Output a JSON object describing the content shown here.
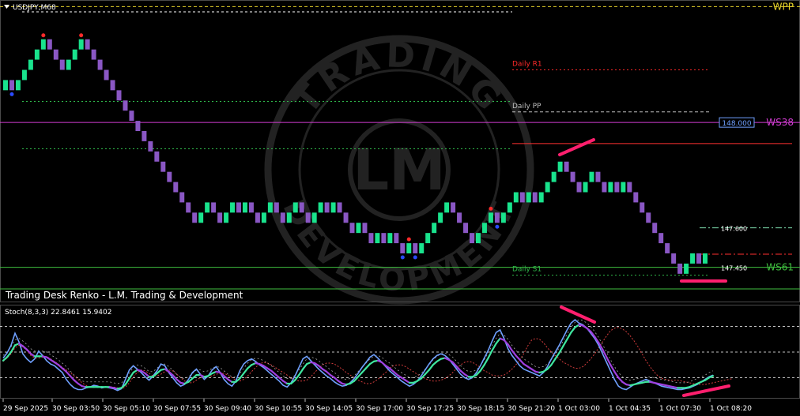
{
  "window": {
    "symbol_title": "USDJPY,M68",
    "indicator_title": "Trading Desk Renko - L.M. Trading & Development",
    "watermark": {
      "line1": "TRADING",
      "logo": "LM",
      "line2": "DEVELOPMENT"
    }
  },
  "colors": {
    "background": "#000000",
    "bull": "#19e38d",
    "bear": "#8a57c4",
    "accent": "#ff1f6e",
    "wpp": "#e6d22a",
    "ws38": "#d23cd2",
    "ws61": "#3fbf3f",
    "daily_r1": "#ff2a2a",
    "daily_pp": "#bfbfbf",
    "daily_s1": "#2fb84a",
    "stoch_main": "#6fa0ff",
    "stoch_signal": "#d23c3c",
    "stoch_smooth_up": "#3fe7a0",
    "stoch_smooth_down": "#a040e0"
  },
  "chart_data": [
    {
      "type": "renko",
      "symbol": "USDJPY",
      "timeframe": "M68",
      "ylim": [
        147.38,
        148.45
      ],
      "bricks": [
        {
          "dir": "up",
          "count": 1
        },
        {
          "dir": "down",
          "count": 1
        },
        {
          "dir": "up",
          "count": 5
        },
        {
          "dir": "down",
          "count": 3
        },
        {
          "dir": "up",
          "count": 3
        },
        {
          "dir": "down",
          "count": 18
        },
        {
          "dir": "up",
          "count": 2
        },
        {
          "dir": "down",
          "count": 2
        },
        {
          "dir": "up",
          "count": 2
        },
        {
          "dir": "down",
          "count": 1
        },
        {
          "dir": "up",
          "count": 1
        },
        {
          "dir": "down",
          "count": 2
        },
        {
          "dir": "up",
          "count": 2
        },
        {
          "dir": "down",
          "count": 2
        },
        {
          "dir": "up",
          "count": 2
        },
        {
          "dir": "down",
          "count": 2
        },
        {
          "dir": "up",
          "count": 2
        },
        {
          "dir": "down",
          "count": 1
        },
        {
          "dir": "up",
          "count": 1
        },
        {
          "dir": "down",
          "count": 3
        },
        {
          "dir": "up",
          "count": 1
        },
        {
          "dir": "down",
          "count": 2
        },
        {
          "dir": "up",
          "count": 1
        },
        {
          "dir": "down",
          "count": 1
        },
        {
          "dir": "up",
          "count": 1
        },
        {
          "dir": "down",
          "count": 2
        },
        {
          "dir": "up",
          "count": 1
        },
        {
          "dir": "down",
          "count": 1
        },
        {
          "dir": "up",
          "count": 5
        },
        {
          "dir": "down",
          "count": 4
        },
        {
          "dir": "up",
          "count": 3
        },
        {
          "dir": "down",
          "count": 1
        },
        {
          "dir": "up",
          "count": 3
        },
        {
          "dir": "down",
          "count": 1
        },
        {
          "dir": "up",
          "count": 1
        },
        {
          "dir": "down",
          "count": 1
        },
        {
          "dir": "up",
          "count": 4
        },
        {
          "dir": "down",
          "count": 3
        },
        {
          "dir": "up",
          "count": 2
        },
        {
          "dir": "down",
          "count": 2
        },
        {
          "dir": "up",
          "count": 1
        },
        {
          "dir": "down",
          "count": 1
        },
        {
          "dir": "up",
          "count": 1
        },
        {
          "dir": "down",
          "count": 9
        },
        {
          "dir": "up",
          "count": 2
        },
        {
          "dir": "down",
          "count": 1
        },
        {
          "dir": "up",
          "count": 1
        }
      ],
      "levels": [
        {
          "name": "WPP",
          "price": 148.44,
          "color": "#e6d22a",
          "style": "dashed",
          "label_side": "right"
        },
        {
          "name": "Daily R1",
          "price": 148.2,
          "color": "#ff2a2a",
          "style": "dotted",
          "label_side": "inline"
        },
        {
          "name": "Daily PP",
          "price": 148.04,
          "color": "#bfbfbf",
          "style": "dashed",
          "label_side": "inline"
        },
        {
          "name": "WS38",
          "price": 148.0,
          "color": "#d23cd2",
          "style": "solid",
          "label_side": "right"
        },
        {
          "name": "WS61",
          "price": 147.45,
          "color": "#3fbf3f",
          "style": "solid",
          "label_side": "right"
        },
        {
          "name": "Daily S1",
          "price": 147.42,
          "color": "#2fb84a",
          "style": "dotted",
          "label_side": "inline"
        }
      ],
      "price_labels": [
        "148.000",
        "147.600",
        "147.450"
      ],
      "extra_price_lines": [
        {
          "price": 147.92,
          "color": "#ff3030",
          "style": "solid"
        },
        {
          "price": 147.6,
          "color": "#7fe0b0",
          "style": "dashdot"
        },
        {
          "price": 147.5,
          "color": "#ff3030",
          "style": "dashdot"
        }
      ],
      "dotted_green_levels": [
        148.08,
        147.9
      ],
      "dotted_white_level": 148.42
    },
    {
      "type": "line",
      "title": "Stoch(8,3,3) 22.8461 15.9402",
      "ylim": [
        0,
        100
      ],
      "levels": [
        20,
        50,
        80
      ],
      "series": [
        {
          "key": "main",
          "values": [
            43,
            49,
            58,
            72,
            62,
            48,
            42,
            38,
            42,
            51,
            46,
            40,
            36,
            34,
            30,
            26,
            18,
            12,
            8,
            6,
            6,
            8,
            9,
            11,
            10,
            8,
            9,
            8,
            7,
            5,
            7,
            18,
            29,
            34,
            30,
            26,
            21,
            17,
            22,
            28,
            36,
            34,
            26,
            20,
            14,
            10,
            12,
            18,
            26,
            30,
            24,
            18,
            22,
            29,
            33,
            26,
            18,
            13,
            10,
            16,
            28,
            36,
            40,
            42,
            39,
            35,
            32,
            28,
            24,
            20,
            16,
            11,
            9,
            14,
            22,
            32,
            42,
            45,
            40,
            35,
            30,
            26,
            22,
            19,
            15,
            12,
            10,
            11,
            14,
            19,
            25,
            32,
            38,
            44,
            47,
            43,
            38,
            33,
            28,
            24,
            20,
            16,
            13,
            10,
            12,
            16,
            22,
            29,
            36,
            42,
            46,
            48,
            46,
            42,
            36,
            30,
            24,
            20,
            18,
            20,
            26,
            34,
            43,
            52,
            63,
            73,
            76,
            66,
            54,
            46,
            40,
            34,
            30,
            28,
            26,
            24,
            22,
            26,
            33,
            42,
            50,
            58,
            67,
            76,
            84,
            88,
            84,
            82,
            78,
            72,
            66,
            58,
            48,
            38,
            28,
            18,
            10,
            7,
            6,
            9,
            12,
            14,
            16,
            18,
            16,
            14,
            12,
            10,
            9,
            8,
            7,
            6,
            6,
            7,
            8,
            10,
            12,
            15,
            18,
            21,
            23
          ]
        },
        {
          "key": "signal",
          "values": [
            39,
            43,
            48,
            55,
            58,
            56,
            52,
            46,
            43,
            43,
            44,
            45,
            42,
            39,
            36,
            32,
            29,
            26,
            22,
            18,
            14,
            11,
            9,
            9,
            9,
            9,
            9,
            9,
            9,
            8,
            7,
            9,
            14,
            21,
            26,
            29,
            28,
            25,
            22,
            22,
            24,
            27,
            29,
            28,
            24,
            20,
            16,
            14,
            14,
            17,
            20,
            21,
            22,
            22,
            24,
            25,
            25,
            23,
            20,
            17,
            16,
            18,
            22,
            27,
            32,
            36,
            38,
            37,
            35,
            32,
            29,
            26,
            23,
            20,
            18,
            16,
            16,
            17,
            21,
            26,
            31,
            35,
            37,
            37,
            36,
            33,
            30,
            26,
            23,
            20,
            17,
            15,
            13,
            13,
            15,
            18,
            22,
            26,
            31,
            34,
            35,
            35,
            33,
            30,
            27,
            24,
            21,
            19,
            17,
            16,
            16,
            17,
            19,
            22,
            26,
            31,
            35,
            38,
            39,
            38,
            35,
            32,
            28,
            26,
            23,
            22,
            22,
            23,
            26,
            30,
            35,
            41,
            48,
            57,
            64,
            66,
            65,
            61,
            55,
            50,
            46,
            42,
            38,
            36,
            33,
            31,
            31,
            33,
            37,
            42,
            48,
            55,
            62,
            69,
            75,
            78,
            79,
            77,
            74,
            69,
            63,
            56,
            48,
            40,
            33,
            27,
            22,
            19,
            18,
            17,
            17,
            17,
            16,
            15,
            14,
            13,
            12,
            12,
            12,
            13,
            14,
            15,
            16,
            17,
            18,
            19
          ]
        },
        {
          "key": "smooth",
          "values": [
            40,
            44,
            50,
            58,
            60,
            57,
            53,
            48,
            45,
            45,
            45,
            44,
            41,
            38,
            35,
            31,
            27,
            22,
            17,
            13,
            10,
            9,
            9,
            9,
            9,
            9,
            9,
            9,
            8,
            7,
            8,
            12,
            19,
            26,
            29,
            28,
            25,
            21,
            21,
            25,
            29,
            30,
            27,
            23,
            18,
            14,
            13,
            15,
            19,
            23,
            23,
            21,
            22,
            25,
            27,
            26,
            22,
            18,
            15,
            15,
            19,
            25,
            31,
            35,
            37,
            36,
            34,
            31,
            28,
            24,
            20,
            16,
            13,
            13,
            17,
            23,
            30,
            36,
            38,
            37,
            34,
            30,
            27,
            23,
            20,
            16,
            13,
            12,
            13,
            16,
            21,
            26,
            31,
            36,
            39,
            40,
            38,
            34,
            31,
            27,
            23,
            20,
            17,
            14,
            14,
            16,
            19,
            24,
            29,
            35,
            39,
            42,
            43,
            41,
            38,
            33,
            28,
            24,
            21,
            21,
            23,
            28,
            35,
            43,
            52,
            60,
            66,
            64,
            59,
            52,
            46,
            41,
            36,
            33,
            30,
            27,
            26,
            27,
            30,
            35,
            42,
            49,
            57,
            65,
            73,
            79,
            82,
            81,
            78,
            74,
            68,
            61,
            53,
            44,
            35,
            27,
            20,
            15,
            12,
            11,
            12,
            13,
            14,
            15,
            15,
            14,
            13,
            12,
            11,
            10,
            9,
            8,
            8,
            8,
            9,
            11,
            13,
            15,
            17,
            20,
            22
          ]
        }
      ],
      "x_tick_labels": [
        "29 Sep 2025",
        "30 Sep 03:50",
        "30 Sep 05:10",
        "30 Sep 07:55",
        "30 Sep 09:40",
        "30 Sep 10:55",
        "30 Sep 14:05",
        "30 Sep 17:00",
        "30 Sep 17:25",
        "30 Sep 18:15",
        "30 Sep 21:20",
        "1 Oct 03:00",
        "1 Oct 04:35",
        "1 Oct 07:30",
        "1 Oct 08:20"
      ]
    }
  ]
}
